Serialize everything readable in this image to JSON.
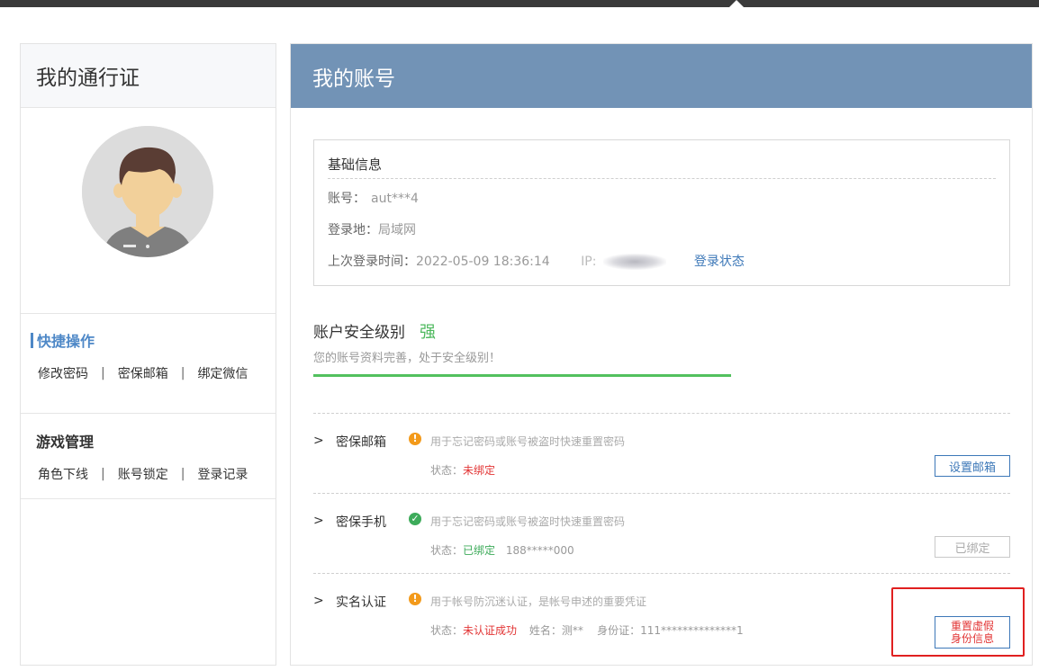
{
  "sidebar": {
    "title": "我的通行证",
    "quick": {
      "title": "快捷操作",
      "links": [
        "修改密码",
        "密保邮箱",
        "绑定微信"
      ],
      "separator": "|"
    },
    "game": {
      "title": "游戏管理",
      "links": [
        "角色下线",
        "账号锁定",
        "登录记录"
      ],
      "separator": "|"
    }
  },
  "main": {
    "title": "我的账号",
    "basic": {
      "title": "基础信息",
      "account_label": "账号：",
      "account_value": "aut***4",
      "location_label": "登录地：",
      "location_value": "局域网",
      "last_login_label": "上次登录时间：",
      "last_login_value": "2022-05-09 18:36:14",
      "ip_label": "IP:",
      "login_status_link": "登录状态"
    },
    "security": {
      "label": "账户安全级别",
      "level": "强",
      "desc": "您的账号资料完善，处于安全级别！",
      "progress": 0.6,
      "bar_color": "#52c15e"
    },
    "items": [
      {
        "arrow": ">",
        "name": "密保邮箱",
        "badge": "!",
        "desc": "用于忘记密码或账号被盗时快速重置密码",
        "status_label": "状态：",
        "status_value": "未绑定",
        "extra": "",
        "button": "设置邮箱"
      },
      {
        "arrow": ">",
        "name": "密保手机",
        "badge": "✓",
        "desc": "用于忘记密码或账号被盗时快速重置密码",
        "status_label": "状态：",
        "status_value": "已绑定",
        "extra": "188*****000",
        "button": "已绑定"
      },
      {
        "arrow": ">",
        "name": "实名认证",
        "badge": "!",
        "desc": "用于帐号防沉迷认证，是帐号申述的重要凭证",
        "status_label": "状态：",
        "status_value": "未认证成功",
        "extra": "姓名：测**    身份证：111**************1",
        "button_line1": "重置虚假",
        "button_line2": "身份信息"
      }
    ]
  },
  "colors": {
    "header_bg": "#7293b6",
    "link": "#3d78b8",
    "danger": "#e23434",
    "success": "#3dab5a",
    "warning": "#f39a1b",
    "highlight_box": "#e02020"
  },
  "icons": [
    "user-avatar-icon",
    "warning-icon",
    "check-circle-icon",
    "chevron-right-icon"
  ]
}
